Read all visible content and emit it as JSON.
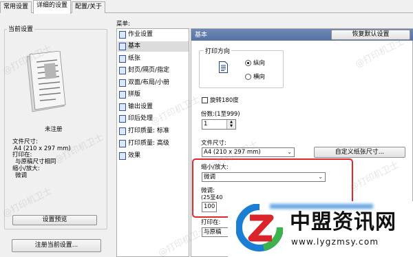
{
  "tabs": [
    "常用设置",
    "详细的设置",
    "配置/关于"
  ],
  "left": {
    "current_settings_title": "当前设置",
    "unregistered": "未注册",
    "paper_size_label": "文件尺寸:",
    "paper_size_value": "A4 (210 x 297 mm)",
    "print_on_label": "打印在:",
    "print_on_value": "与原稿尺寸相同",
    "scale_label": "缩小/放大:",
    "scale_value": "微调",
    "preview_button": "设置预览",
    "register_button": "注册当前设置..."
  },
  "menu": {
    "title": "菜单:",
    "items": [
      "作业设置",
      "基本",
      "纸张",
      "封页/隔页/指定",
      "双面/布局/小册",
      "拼版",
      "输出设置",
      "印后处理",
      "打印质量: 标准",
      "打印质量: 高级",
      "效果"
    ],
    "selected_index": 1
  },
  "right": {
    "header_title": "基本",
    "restore_button": "恢复默认设置",
    "orientation_title": "打印方向",
    "portrait": "纵向",
    "landscape": "横向",
    "orientation_selected": "portrait",
    "rotate_label": "旋转180度",
    "rotate_checked": false,
    "copies_label": "份数:(1至999)",
    "copies_value": "1",
    "paper_size_label": "文件尺寸:",
    "paper_size_value": "A4 (210 x 297 mm)",
    "custom_size_button": "自定义纸张尺寸...",
    "scale_label": "缩小/放大:",
    "scale_value": "微调",
    "fine_label": "微调:",
    "fine_range": "(25至40",
    "fine_value": "100",
    "print_on_label": "打印在:",
    "print_on_value": "与原稿"
  },
  "watermark": "@打印机卫士",
  "overlay_logo": {
    "title": "中盟资讯网",
    "url": "www.lygzmsy.com"
  },
  "colors": {
    "header_blue": "#5a76a8",
    "highlight_red": "#e0262a",
    "logo_blue": "#1a7fd4",
    "logo_green": "#3bb34a",
    "logo_red": "#d9252a"
  }
}
